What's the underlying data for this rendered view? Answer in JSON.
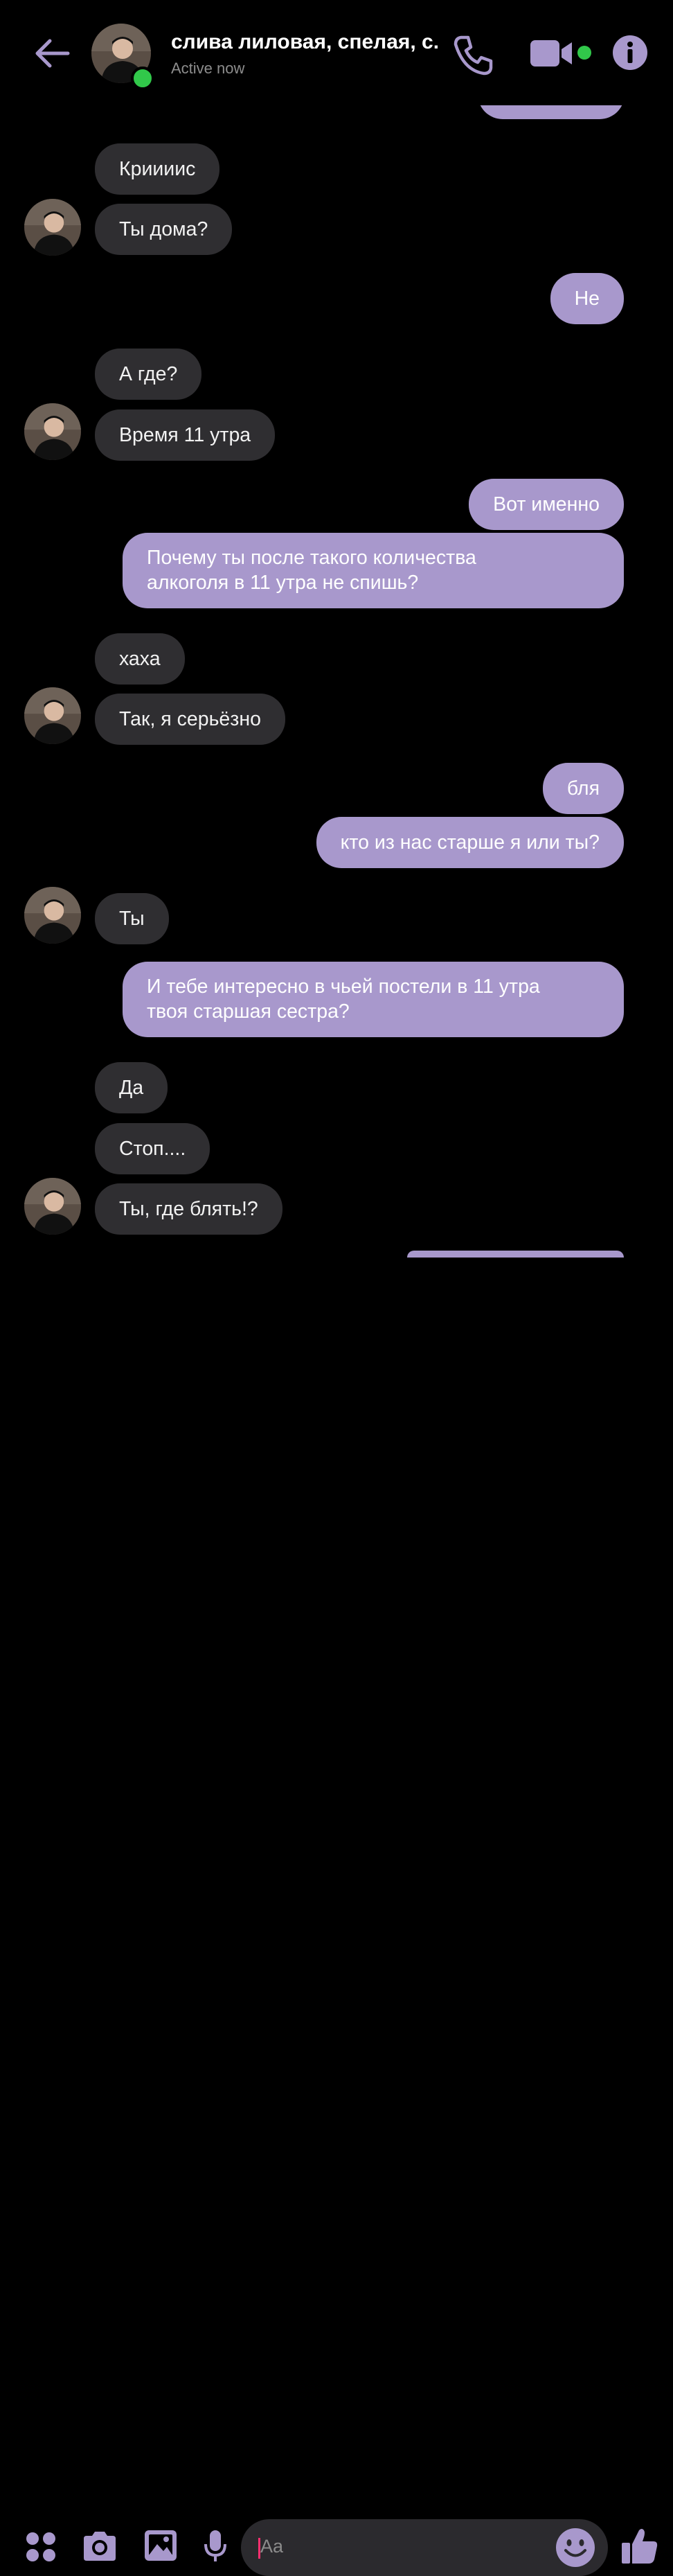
{
  "header": {
    "title": "слива лиловая, спелая, с...",
    "status": "Active now"
  },
  "messages": [
    {
      "text": "Криииис"
    },
    {
      "text": "Ты дома?"
    },
    {
      "text": "Не"
    },
    {
      "text": "А где?"
    },
    {
      "text": "Время 11 утра"
    },
    {
      "text": "Вот именно"
    },
    {
      "text": "Почему ты после такого количества\nалкоголя в 11 утра не спишь?"
    },
    {
      "text": "хаха"
    },
    {
      "text": "Так, я серьёзно"
    },
    {
      "text": "бля"
    },
    {
      "text": "кто из нас старше я или ты?"
    },
    {
      "text": "Ты"
    },
    {
      "text": "И тебе интересно в чьей постели в 11 утра\nтвоя старшая сестра?"
    },
    {
      "text": "Да"
    },
    {
      "text": "Стоп...."
    },
    {
      "text": "Ты, где блять!?"
    }
  ],
  "composer": {
    "placeholder": "Aa"
  },
  "colors": {
    "accent": "#a898cc",
    "incoming_bubble": "#2f2e31",
    "online": "#31c84a",
    "background": "#000000"
  },
  "icons": [
    "back-arrow-icon",
    "phone-icon",
    "video-camera-icon",
    "info-icon",
    "apps-icon",
    "camera-icon",
    "gallery-icon",
    "microphone-icon",
    "emoji-icon",
    "thumbs-up-icon"
  ]
}
